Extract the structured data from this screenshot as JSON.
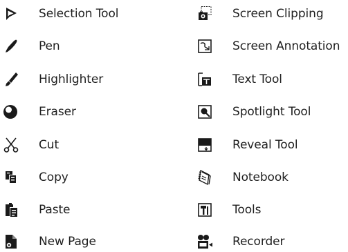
{
  "left_column": [
    {
      "label": "Selection Tool",
      "icon": "selection-arrow-icon"
    },
    {
      "label": "Pen",
      "icon": "pen-icon"
    },
    {
      "label": "Highlighter",
      "icon": "highlighter-icon"
    },
    {
      "label": "Eraser",
      "icon": "eraser-icon"
    },
    {
      "label": "Cut",
      "icon": "scissors-icon"
    },
    {
      "label": "Copy",
      "icon": "copy-icon"
    },
    {
      "label": "Paste",
      "icon": "paste-icon"
    },
    {
      "label": "New Page",
      "icon": "new-page-icon"
    }
  ],
  "right_column": [
    {
      "label": "Screen Clipping",
      "icon": "screen-clipping-icon"
    },
    {
      "label": "Screen Annotation",
      "icon": "screen-annotation-icon"
    },
    {
      "label": "Text Tool",
      "icon": "text-tool-icon"
    },
    {
      "label": "Spotlight Tool",
      "icon": "spotlight-icon"
    },
    {
      "label": "Reveal Tool",
      "icon": "reveal-icon"
    },
    {
      "label": "Notebook",
      "icon": "notebook-icon"
    },
    {
      "label": "Tools",
      "icon": "tools-icon"
    },
    {
      "label": "Recorder",
      "icon": "recorder-icon"
    }
  ],
  "colors": {
    "icon": "#1a1a1a",
    "text": "#1f1f1f",
    "background": "#ffffff"
  }
}
